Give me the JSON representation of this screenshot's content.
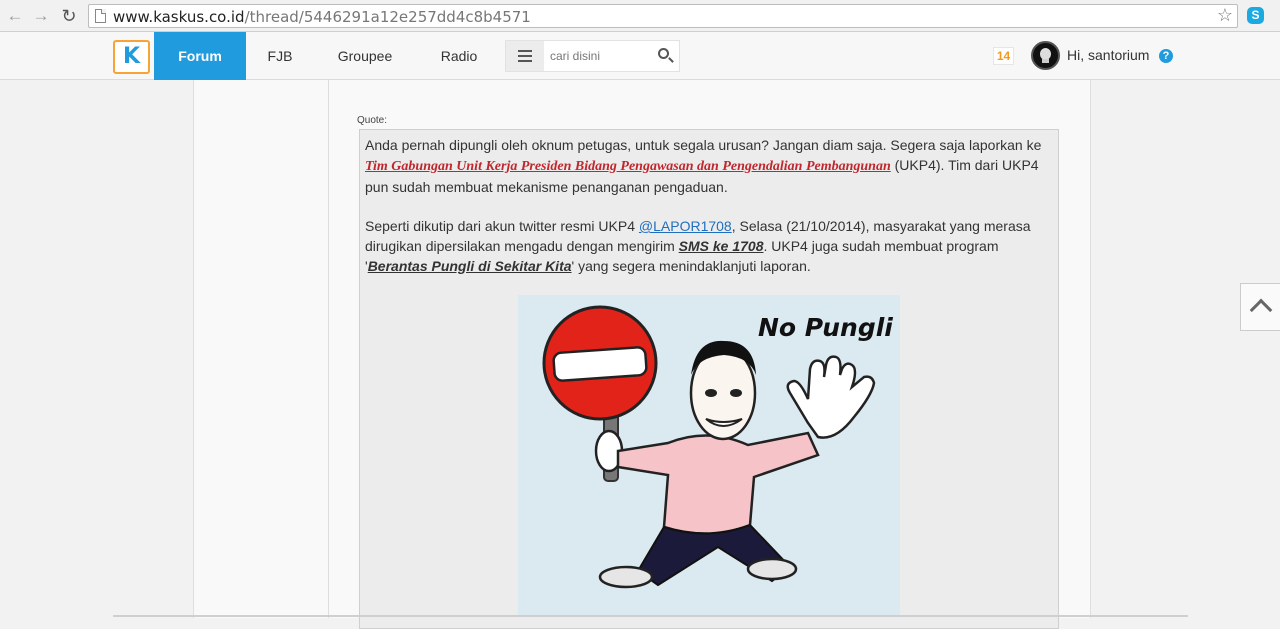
{
  "browser": {
    "url_host": "www.kaskus.co.id",
    "url_path": "/thread/5446291a12e257dd4c8b4571"
  },
  "nav": {
    "tabs": [
      "Forum",
      "FJB",
      "Groupee",
      "Radio"
    ],
    "active_tab": "Forum",
    "search_placeholder": "cari disini",
    "notif_count": "14",
    "greeting": "Hi, santorium"
  },
  "post": {
    "quote_label": "Quote:",
    "p1_before": "Anda pernah dipungli oleh oknum petugas, untuk segala urusan? Jangan diam saja. Segera saja laporkan ke ",
    "p1_link": "Tim Gabungan Unit Kerja Presiden Bidang Pengawasan dan Pengendalian Pembangunan",
    "p1_after": " (UKP4). Tim dari UKP4 pun sudah membuat mekanisme penanganan pengaduan.",
    "p2_before": "Seperti dikutip dari akun twitter resmi UKP4 ",
    "p2_handle": "@LAPOR1708",
    "p2_mid": ", Selasa (21/10/2014), masyarakat yang merasa dirugikan dipersilakan mengadu dengan mengirim ",
    "p2_sms": "SMS ke 1708",
    "p2_mid2": ". UKP4 juga sudah membuat program '",
    "p2_program": "Berantas Pungli di Sekitar Kita",
    "p2_after": "' yang segera menindaklanjuti laporan.",
    "image_caption": "No Pungli"
  }
}
